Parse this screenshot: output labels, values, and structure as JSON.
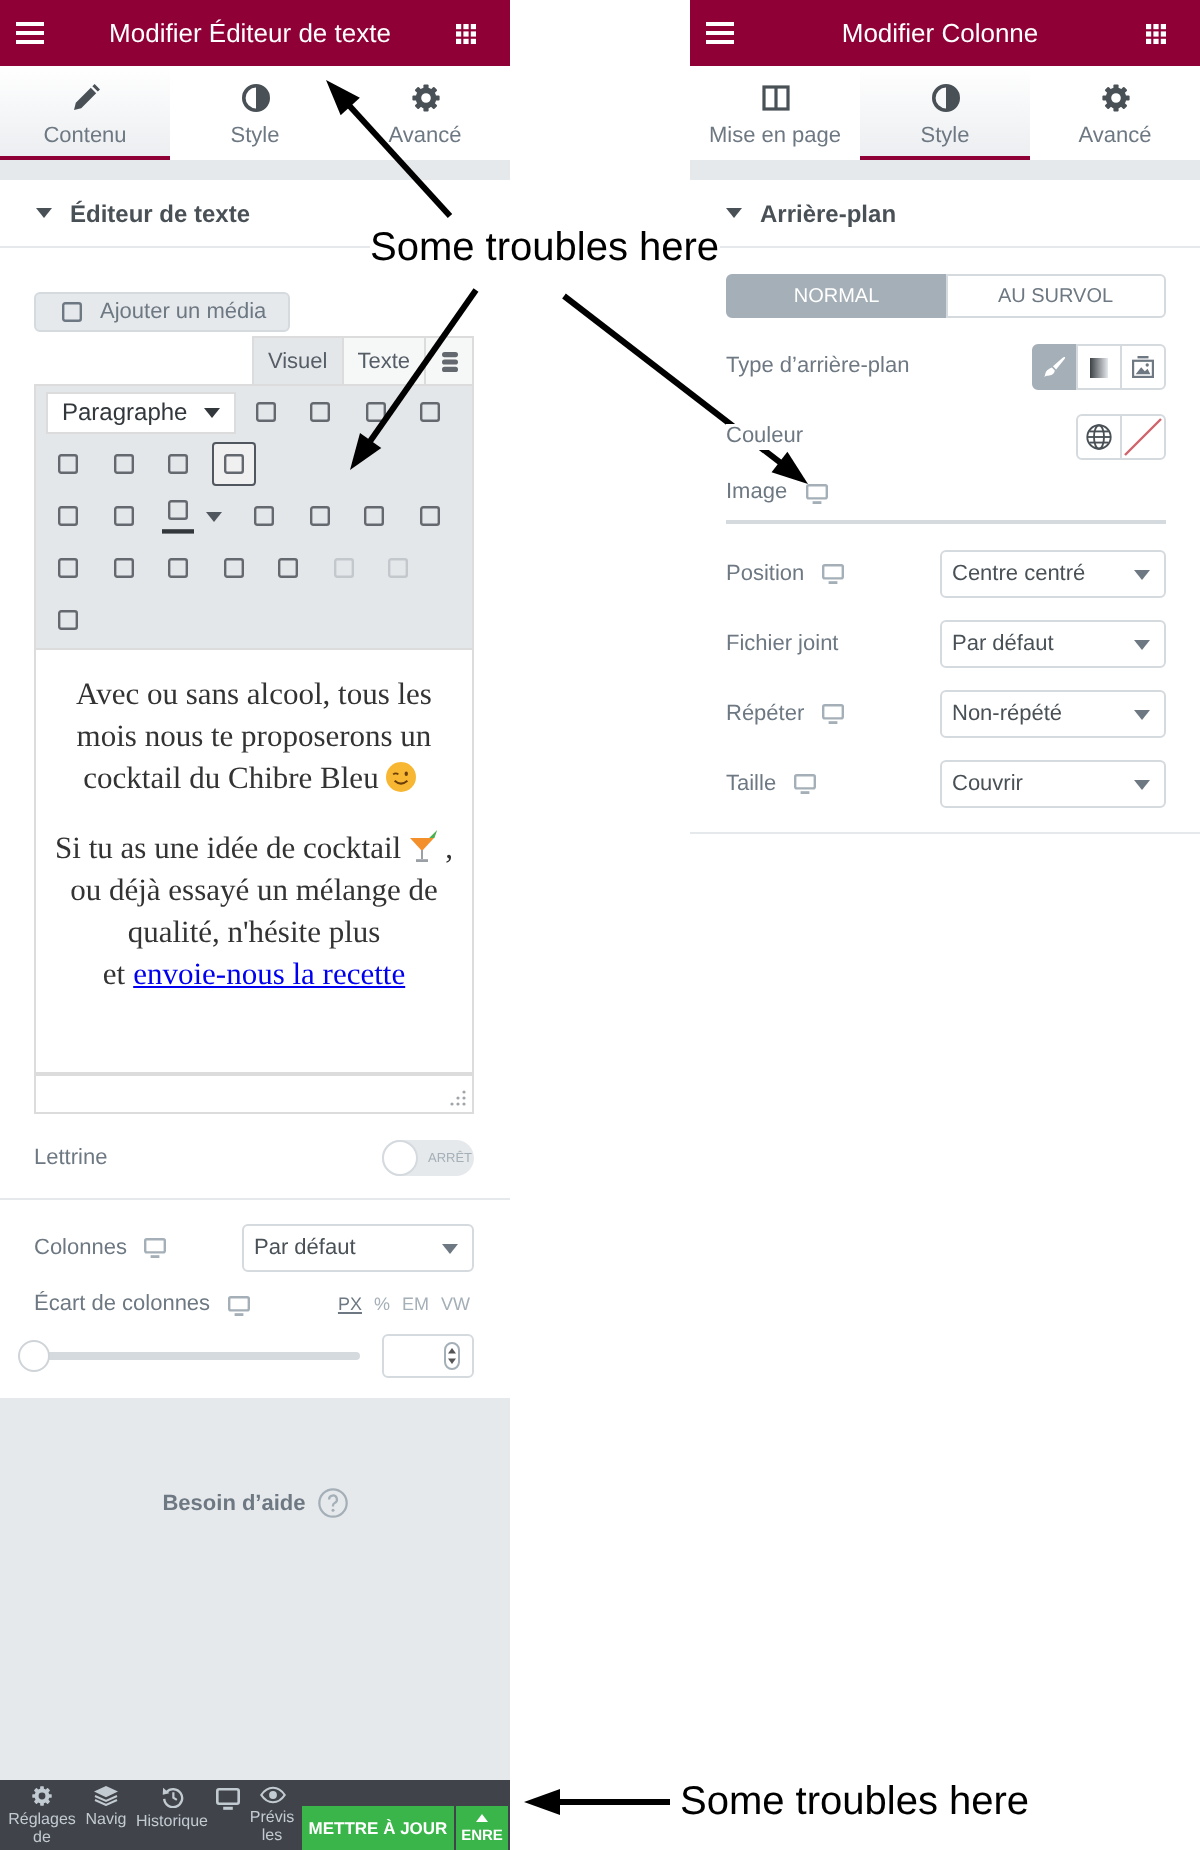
{
  "left_panel": {
    "header": {
      "title": "Modifier Éditeur de texte"
    },
    "tabs": [
      {
        "label": "Contenu",
        "selected": true
      },
      {
        "label": "Style",
        "selected": false
      },
      {
        "label": "Avancé",
        "selected": false
      }
    ],
    "section": {
      "title": "Éditeur de texte",
      "expanded": true
    },
    "editor": {
      "add_media_button": "Ajouter un média",
      "mode_tabs": [
        {
          "label": "Visuel",
          "selected": true
        },
        {
          "label": "Texte",
          "selected": false
        }
      ],
      "format_select": "Paragraphe",
      "toolbars": [
        [
          {
            "kind": "button",
            "pressed": false,
            "disabled": false
          },
          {
            "kind": "button",
            "pressed": false,
            "disabled": false
          },
          {
            "kind": "button",
            "pressed": false,
            "disabled": false
          },
          {
            "kind": "button",
            "pressed": false,
            "disabled": false
          },
          {
            "kind": "button",
            "pressed": false,
            "disabled": false
          },
          {
            "kind": "button",
            "pressed": false,
            "disabled": false
          },
          {
            "kind": "button",
            "pressed": false,
            "disabled": false
          },
          {
            "kind": "button",
            "pressed": true,
            "disabled": false
          }
        ],
        [
          {
            "kind": "button",
            "pressed": false,
            "disabled": false
          },
          {
            "kind": "button",
            "pressed": false,
            "disabled": false
          },
          {
            "kind": "color",
            "pressed": false,
            "disabled": false
          },
          {
            "kind": "button",
            "pressed": false,
            "disabled": false
          },
          {
            "kind": "button",
            "pressed": false,
            "disabled": false
          },
          {
            "kind": "button",
            "pressed": false,
            "disabled": false
          },
          {
            "kind": "button",
            "pressed": false,
            "disabled": false
          },
          {
            "kind": "button",
            "pressed": false,
            "disabled": false
          },
          {
            "kind": "button",
            "pressed": false,
            "disabled": false
          },
          {
            "kind": "button",
            "pressed": false,
            "disabled": false
          },
          {
            "kind": "button",
            "pressed": false,
            "disabled": false
          },
          {
            "kind": "button",
            "pressed": false,
            "disabled": false
          },
          {
            "kind": "button",
            "pressed": false,
            "disabled": true
          },
          {
            "kind": "button",
            "pressed": false,
            "disabled": true
          },
          {
            "kind": "button",
            "pressed": false,
            "disabled": false
          }
        ]
      ],
      "paragraphs": [
        {
          "parts": [
            {
              "kind": "text",
              "text": "Avec ou sans alcool, tous les mois nous te proposerons un cocktail du Chibre Bleu"
            },
            {
              "kind": "emoji"
            }
          ]
        },
        {
          "parts": [
            {
              "kind": "text",
              "text": "Si tu as une idée de cocktail"
            },
            {
              "kind": "emoji"
            },
            {
              "kind": "text",
              "text": ", ou déjà essayé un mélange de qualité, n'hésite plus et"
            },
            {
              "kind": "link",
              "text": "envoie-nous la recette"
            }
          ]
        }
      ]
    },
    "drop_cap": {
      "label": "Lettrine",
      "on": false,
      "switch_text": "ARRÊT"
    },
    "columns": {
      "label": "Colonnes",
      "responsive": true,
      "value": "Par défaut"
    },
    "column_gap": {
      "label": "Écart de colonnes",
      "responsive": true,
      "units": [
        {
          "label": "PX",
          "selected": true
        },
        {
          "label": "%",
          "selected": false
        },
        {
          "label": "EM",
          "selected": false
        },
        {
          "label": "VW",
          "selected": false
        }
      ],
      "level": 0
    },
    "help_link": "Besoin d’aide",
    "footer": {
      "tools": [
        {
          "kind": "labeled",
          "label": "Réglages de"
        },
        {
          "kind": "labeled",
          "label": "Navig"
        },
        {
          "kind": "labeled",
          "label": "Historique"
        },
        {
          "kind": "icon"
        },
        {
          "kind": "labeled",
          "label": "Prévis les"
        }
      ],
      "publish_button": "METTRE À JOUR",
      "save_options_button": "ENRE"
    }
  },
  "right_panel": {
    "header": {
      "title": "Modifier Colonne"
    },
    "tabs": [
      {
        "label": "Mise en page",
        "selected": false
      },
      {
        "label": "Style",
        "selected": true
      },
      {
        "label": "Avancé",
        "selected": false
      }
    ],
    "section": {
      "title": "Arrière-plan",
      "expanded": true
    },
    "state_tabs": [
      {
        "label": "NORMAL",
        "selected": true
      },
      {
        "label": "AU SURVOL",
        "selected": false
      }
    ],
    "background_type": {
      "label": "Type d’arrière-plan",
      "options": [
        {
          "selected": true
        },
        {
          "selected": false
        },
        {
          "selected": false
        }
      ]
    },
    "color": {
      "label": "Couleur"
    },
    "image": {
      "label": "Image",
      "responsive": true
    },
    "fields": [
      {
        "label": "Position",
        "responsive": true,
        "value": "Centre centré"
      },
      {
        "label": "Fichier joint",
        "responsive": false,
        "value": "Par défaut"
      },
      {
        "label": "Répéter",
        "responsive": true,
        "value": "Non-répété"
      },
      {
        "label": "Taille",
        "responsive": true,
        "value": "Couvrir"
      }
    ]
  },
  "annotations": [
    {
      "text": "Some troubles here"
    },
    {
      "text": "Some troubles here"
    }
  ]
}
